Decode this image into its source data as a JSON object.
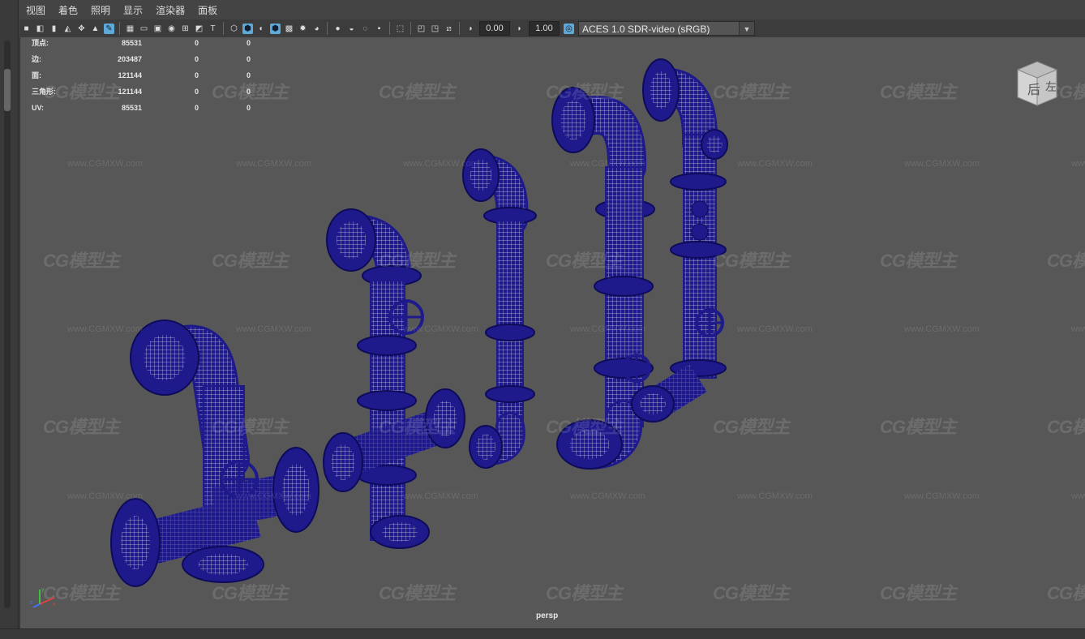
{
  "menu": [
    "视图",
    "着色",
    "照明",
    "显示",
    "渲染器",
    "面板"
  ],
  "toolbar": {
    "exposure_value": "0.00",
    "gamma_value": "1.00",
    "color_management": "ACES 1.0 SDR-video (sRGB)",
    "icons": [
      "camera-icon",
      "bookmark-icon",
      "image-plane-icon",
      "grid-icon",
      "film-gate-icon",
      "resolution-gate-icon",
      "wireframe-icon",
      "smooth-shade-icon",
      "textured-icon",
      "lights-icon",
      "shadows-icon",
      "ao-icon",
      "isolate-icon",
      "xray-icon",
      "exposure-icon",
      "gamma-icon",
      "color-management-icon"
    ]
  },
  "hud": {
    "rows": [
      {
        "label": "顶点:",
        "v1": "85531",
        "v2": "0",
        "v3": "0"
      },
      {
        "label": "边:",
        "v1": "203487",
        "v2": "0",
        "v3": "0"
      },
      {
        "label": "面:",
        "v1": "121144",
        "v2": "0",
        "v3": "0"
      },
      {
        "label": "三角形:",
        "v1": "121144",
        "v2": "0",
        "v3": "0"
      },
      {
        "label": "UV:",
        "v1": "85531",
        "v2": "0",
        "v3": "0"
      }
    ]
  },
  "viewport": {
    "camera": "persp",
    "viewcube_labels": [
      "后",
      "左"
    ],
    "watermark_brand": "CG模型主",
    "watermark_url": "www.CGMXW.com",
    "wire_color": "#1e1a8c",
    "axis_labels": [
      "x",
      "y",
      "z"
    ]
  },
  "colors": {
    "accent": "#5fa9d8",
    "background": "#575757",
    "panel": "#3c3c3c"
  }
}
